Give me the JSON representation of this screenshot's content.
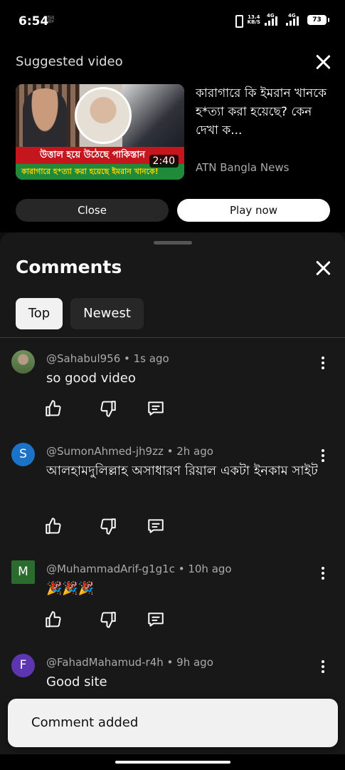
{
  "status_bar": {
    "time": "6:54",
    "speed_value": "13.4",
    "speed_unit": "KB/S",
    "network_1": "4G",
    "network_2": "4G",
    "battery": "73"
  },
  "suggested": {
    "heading": "Suggested video",
    "video_title": "কারাগারে কি ইমরান খানকে হ*ত্যা করা হয়েছে?  কেন দেখা ক...",
    "channel": "ATN Bangla News",
    "duration": "2:40",
    "thumbnail_line1": "উত্তাল হয়ে উঠেছে পাকিস্তান",
    "thumbnail_line2": "কারাগারে হ*ত্যা করা হয়েছে ইমরান খানকে!",
    "close_label": "Close",
    "play_label": "Play now"
  },
  "comments_sheet": {
    "title": "Comments",
    "filters": [
      "Top",
      "Newest"
    ],
    "active_filter": "Top",
    "items": [
      {
        "author": "@Sahabul956",
        "time": "1s ago",
        "text": "so good video",
        "avatar_letter": "",
        "avatar_color": "#6f8f5a"
      },
      {
        "author": "@SumonAhmed-jh9zz",
        "time": "2h ago",
        "text": "আলহামদুলিল্লাহ অসাধারণ রিয়াল একটা ইনকাম সাইট",
        "avatar_letter": "S",
        "avatar_color": "#1a73c7"
      },
      {
        "author": "@MuhammadArif-g1g1c",
        "time": "10h ago",
        "text": "🎉🎉🎉",
        "avatar_letter": "M",
        "avatar_color": "#2b6b2e"
      },
      {
        "author": "@FahadMahamud-r4h",
        "time": "9h ago",
        "text": "Good site",
        "avatar_letter": "F",
        "avatar_color": "#5e35b1"
      }
    ]
  },
  "toast": {
    "message": "Comment added"
  },
  "icons": {
    "like": "thumbs-up-icon",
    "dislike": "thumbs-down-icon",
    "reply": "reply-icon",
    "more": "more-vertical-icon",
    "close": "close-icon"
  }
}
